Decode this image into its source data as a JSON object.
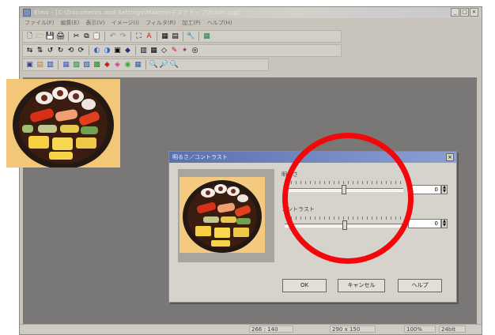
{
  "window": {
    "title": "Elms - [C:\\Documents and Settings\\Makoto\\デスクトップ\\Sushi.jpg]",
    "controls": [
      "_",
      "□",
      "×"
    ]
  },
  "menu": [
    "ファイル(F)",
    "編集(E)",
    "表示(V)",
    "イメージ(I)",
    "フィルタ(R)",
    "加工(P)",
    "ヘルプ(H)"
  ],
  "toolbars": {
    "row1": [
      "🗋",
      "🗁",
      "💾",
      "🖨",
      "✂",
      "⧉",
      "📋",
      "↶",
      "↷",
      "⛶",
      "A",
      "▦",
      "▤",
      "🔧",
      "▦"
    ],
    "row2": [
      "⇆",
      "⇅",
      "↺",
      "↻",
      "⟲",
      "⟳",
      "◐",
      "◑",
      "▣",
      "◆",
      "▥",
      "▦",
      "◇",
      "✎",
      "✦",
      "◎"
    ],
    "row3": [
      "▣",
      "▤",
      "▥",
      "▦",
      "▧",
      "▨",
      "▩",
      "◆",
      "◈",
      "◉",
      "▦",
      "🔍",
      "🔎",
      "🔍"
    ]
  },
  "dialog": {
    "title": "明るさ／コントラスト",
    "brightness_label": "明るさ",
    "brightness_value": "0",
    "contrast_label": "コントラスト",
    "contrast_value": "0",
    "ok_label": "OK",
    "cancel_label": "キャンセル",
    "help_label": "ヘルプ",
    "close_label": "×"
  },
  "status": {
    "coords": "266 : 140",
    "image_size": "290 x 150",
    "zoom": "100%",
    "color_depth": "24bit"
  },
  "colors": {
    "annotation_circle": "#f2080a",
    "workspace": "#7a7876",
    "dialog_title": "#5a70b0"
  }
}
